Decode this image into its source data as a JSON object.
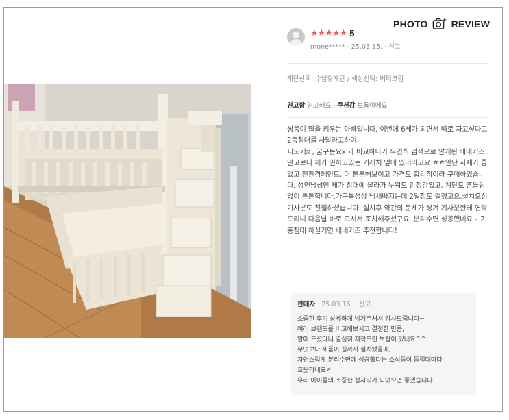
{
  "badge": {
    "label_left": "PHOTO",
    "label_right": "REVIEW",
    "icon": "camera-sparkle-icon"
  },
  "review": {
    "rating": 5,
    "stars": "★★★★★",
    "rating_text": "5",
    "author": "mone*****",
    "date": "25.03.15.",
    "report_label": "신고",
    "options": "계단선택: 수납형계단 / 색상선택: 버터크림",
    "attributes": [
      {
        "name": "견고함",
        "value": "견고해요"
      },
      {
        "name": "쿠션감",
        "value": "보통이에요"
      }
    ],
    "body": "쌍둥이 딸을 키우는 아빠입니다. 이번에 6세가 되면서 따로 자고싶다고 2층침대를 사달라고하여,\n피노키x , 꿈꾸는요x 과 비교하다가 우연히 검색으로 알게된 베네키즈 .  알고보니 제가 일하고있는 거래처 옆에 있더라고요 ㅎㅎ일단 자재가 좋았고 친환경페인트, 더 튼튼해보이고 가격도 합리적이라 구매하였습니다.  성인남성인 제가 침대에 올라가 누워도 안정감있고, 계단도 흔들림없이 튼튼합니다.가구특성상 냄새빠지는데 2일정도 걸렸고요.설치오신 기사분도 친절하셨습니다.  설치후 약간의 문제가 생겨 기사분한테 연락드리니 다음날 바로 오셔서 조치해주셨구요. 분리수면 성공했네요~  2층침대 하실거면 베네키즈 추천합니다!"
  },
  "seller_reply": {
    "label": "판매자",
    "date": "25.03.16.",
    "report_label": "신고",
    "text": "소중한 후기 상세하게 남겨주셔서 감사드립니다~\n여러 브랜드를 비교해보시고 결정한 만큼,\n맘에 드셨다니 열심히 제작드린 보람이 있네요^^\n무엇보다 제품이 집까지 설치됐을때,\n자연스럽게 분리수면에 성공했다는 소식들이 들릴때마다\n흐뭇하네요ㅎ\n우리 아이들의 소중한 잠자리가 되었으면 좋겠습니다"
  },
  "colors": {
    "star": "#f05650",
    "reply_bg": "#f5f5f5",
    "border": "#9a9a9a"
  }
}
